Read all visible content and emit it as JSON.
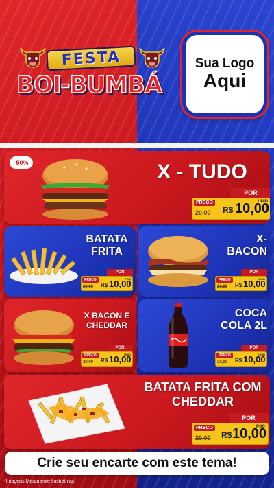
{
  "header": {
    "festa": "FESTA",
    "boi_bumba": "BOI-BUMBÁ",
    "logo_line1": "Sua Logo",
    "logo_line2": "Aqui"
  },
  "items": [
    {
      "name": "X - TUDO",
      "badge": "-50%",
      "preco_label": "PREÇO",
      "por_label": "POR",
      "old_price": "20,00",
      "currency": "R$",
      "price": "10,00",
      "unit": "UNID"
    },
    {
      "name_line1": "BATATA",
      "name_line2": "FRITA",
      "preco_label": "PREÇO",
      "por_label": "POR",
      "old_price": "20,00",
      "currency": "R$",
      "price": "10,00",
      "unit": "POÇ"
    },
    {
      "name_line1": "X-",
      "name_line2": "BACON",
      "preco_label": "PREÇO",
      "por_label": "POR",
      "old_price": "20,00",
      "currency": "R$",
      "price": "10,00",
      "unit": "UNID"
    },
    {
      "name_line1": "X BACON E",
      "name_line2": "CHEDDAR",
      "preco_label": "PREÇO",
      "por_label": "POR",
      "old_price": "20,00",
      "currency": "R$",
      "price": "10,00",
      "unit": "UNID"
    },
    {
      "name_line1": "COCA",
      "name_line2": "COLA 2L",
      "preco_label": "PREÇO",
      "por_label": "POR",
      "old_price": "20,00",
      "currency": "R$",
      "price": "10,00",
      "unit": "UNID"
    },
    {
      "name_line1": "BATATA FRITA COM",
      "name_line2": "CHEDDAR",
      "preco_label": "PREÇO",
      "por_label": "POR",
      "old_price": "20,00",
      "currency": "R$",
      "price": "10,00",
      "unit": "POÇ"
    }
  ],
  "cta": "Crie seu encarte com este tema!",
  "footnote": "*Imagens Meramente Ilustrativas",
  "colors": {
    "red": "#e0262b",
    "blue": "#1e34b8",
    "yellow": "#f7c51a"
  },
  "icons": [
    "bull-icon",
    "burger-icon",
    "fries-icon",
    "soda-bottle-icon"
  ]
}
